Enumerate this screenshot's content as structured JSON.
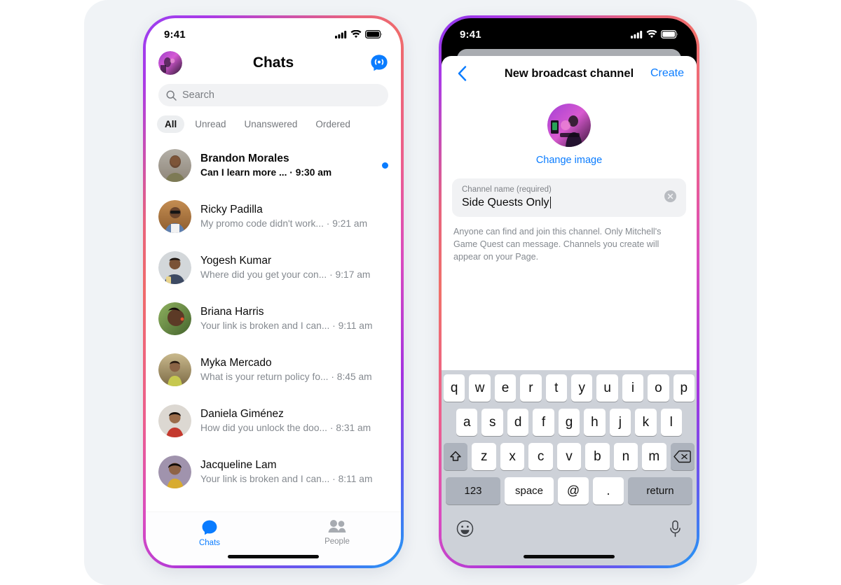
{
  "theme": {
    "page_bg": "#ffffff",
    "card_bg": "#f0f3f6",
    "accent_blue": "#0a7cff",
    "muted_text": "#858a90",
    "keyboard_bg": "#cdd1d8"
  },
  "left_phone": {
    "status": {
      "time": "9:41",
      "cellular_icon": "signal-bars-icon",
      "wifi_icon": "wifi-icon",
      "battery_icon": "battery-icon"
    },
    "header": {
      "avatar_icon": "profile-avatar",
      "title": "Chats",
      "broadcast_icon": "broadcast-channel-icon"
    },
    "search": {
      "placeholder": "Search",
      "icon": "search-icon"
    },
    "filters": [
      {
        "label": "All",
        "active": true
      },
      {
        "label": "Unread",
        "active": false
      },
      {
        "label": "Unanswered",
        "active": false
      },
      {
        "label": "Ordered",
        "active": false
      }
    ],
    "chats": [
      {
        "name": "Brandon Morales",
        "snippet": "Can I learn more ...",
        "time": "9:30 am",
        "unread": true,
        "avatar_bg1": "#a9a49c",
        "avatar_bg2": "#6b5f4e"
      },
      {
        "name": "Ricky Padilla",
        "snippet": "My promo code didn't work...",
        "time": "9:21 am",
        "unread": false,
        "avatar_bg1": "#c08c4e",
        "avatar_bg2": "#8a5c2c"
      },
      {
        "name": "Yogesh Kumar",
        "snippet": "Where did you get your con...",
        "time": "9:17 am",
        "unread": false,
        "avatar_bg1": "#cfd4d8",
        "avatar_bg2": "#6e5a4a"
      },
      {
        "name": "Briana Harris",
        "snippet": "Your link is broken and I can...",
        "time": "9:11 am",
        "unread": false,
        "avatar_bg1": "#7fa255",
        "avatar_bg2": "#3f5a2a"
      },
      {
        "name": "Myka Mercado",
        "snippet": "What is your return policy fo...",
        "time": "8:45 am",
        "unread": false,
        "avatar_bg1": "#b6a27a",
        "avatar_bg2": "#7e6b46"
      },
      {
        "name": "Daniela Giménez",
        "snippet": "How did you unlock the doo...",
        "time": "8:31 am",
        "unread": false,
        "avatar_bg1": "#d8d3cd",
        "avatar_bg2": "#b5392e"
      },
      {
        "name": "Jacqueline Lam",
        "snippet": "Your link is broken and I can...",
        "time": "8:11 am",
        "unread": false,
        "avatar_bg1": "#9a8ca8",
        "avatar_bg2": "#d0a333"
      }
    ],
    "separator": "·",
    "tabs": [
      {
        "label": "Chats",
        "icon": "chat-bubble-icon",
        "active": true
      },
      {
        "label": "People",
        "icon": "people-icon",
        "active": false
      }
    ]
  },
  "right_phone": {
    "status": {
      "time": "9:41",
      "cellular_icon": "signal-bars-icon",
      "wifi_icon": "wifi-icon",
      "battery_icon": "battery-icon"
    },
    "sheet": {
      "back_icon": "back-chevron-icon",
      "title": "New broadcast channel",
      "create_label": "Create",
      "channel_image_icon": "channel-avatar",
      "change_image_label": "Change image",
      "field": {
        "label": "Channel name (required)",
        "value": "Side Quests Only",
        "clear_icon": "clear-circle-icon"
      },
      "helper_text": "Anyone can find and join this channel. Only Mitchell's Game Quest can message. Channels you create will appear on your Page."
    },
    "keyboard": {
      "row1": [
        "q",
        "w",
        "e",
        "r",
        "t",
        "y",
        "u",
        "i",
        "o",
        "p"
      ],
      "row2": [
        "a",
        "s",
        "d",
        "f",
        "g",
        "h",
        "j",
        "k",
        "l"
      ],
      "row3_shift_icon": "shift-key-icon",
      "row3": [
        "z",
        "x",
        "c",
        "v",
        "b",
        "n",
        "m"
      ],
      "row3_backspace_icon": "backspace-key-icon",
      "numbers_label": "123",
      "space_label": "space",
      "at_label": "@",
      "dot_label": ".",
      "return_label": "return",
      "emoji_icon": "emoji-key-icon",
      "mic_icon": "microphone-key-icon"
    }
  }
}
